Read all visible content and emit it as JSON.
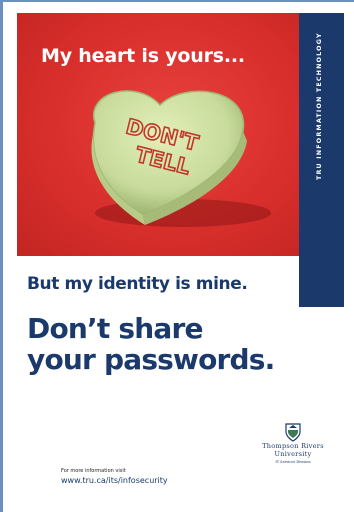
{
  "poster": {
    "headline": "My heart is yours...",
    "candy_text_line1": "DON'T",
    "candy_text_line2": "TELL",
    "sidebar_label": "TRU INFORMATION TECHNOLOGY",
    "tagline": "But my identity is mine.",
    "cta_line1": "Don’t share",
    "cta_line2": "your passwords.",
    "more_info": "For more information visit",
    "url": "www.tru.ca/its/infosecurity",
    "logo_line1": "Thompson Rivers",
    "logo_line2": "University",
    "logo_sub": "IT Services Division"
  },
  "colors": {
    "brand_blue": "#1b3a6b",
    "photo_red": "#d92f2c",
    "candy_green": "#c8db9c",
    "candy_lettering": "#c0392b"
  }
}
